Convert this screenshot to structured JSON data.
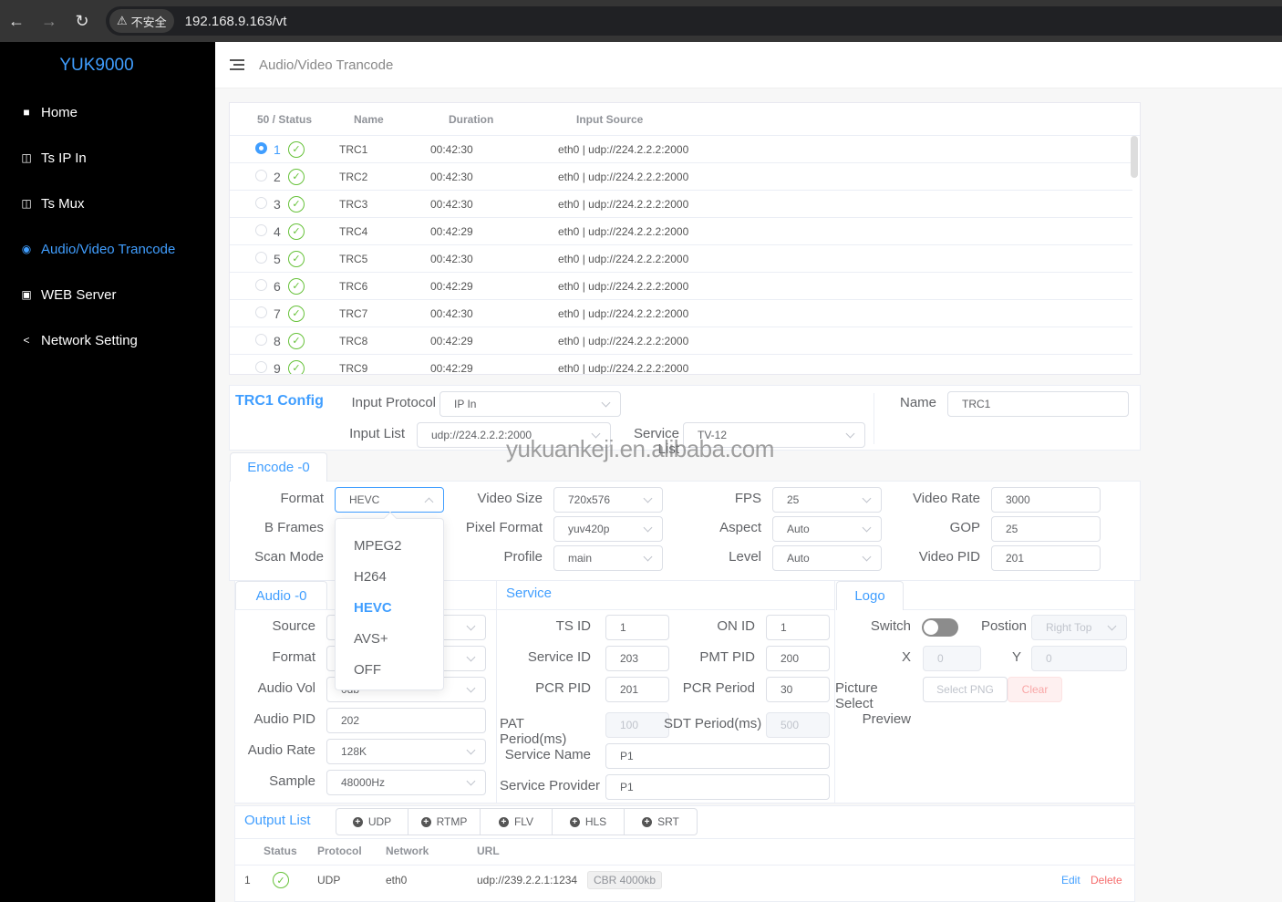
{
  "browser": {
    "insecure_label": "不安全",
    "url": "192.168.9.163/vt"
  },
  "sidebar": {
    "logo": "YUK9000",
    "items": [
      {
        "label": "Home",
        "icon": "monitor-icon",
        "active": false
      },
      {
        "label": "Ts IP In",
        "icon": "notebook-icon",
        "active": false
      },
      {
        "label": "Ts Mux",
        "icon": "notebook-icon",
        "active": false
      },
      {
        "label": "Audio/Video Trancode",
        "icon": "camera-icon",
        "active": true
      },
      {
        "label": "WEB Server",
        "icon": "wallet-icon",
        "active": false
      },
      {
        "label": "Network Setting",
        "icon": "share-icon",
        "active": false
      }
    ]
  },
  "header": {
    "title": "Audio/Video Trancode"
  },
  "channel_table": {
    "headers": [
      "50 / Status",
      "Name",
      "Duration",
      "Input Source"
    ],
    "rows": [
      {
        "index": "1",
        "name": "TRC1",
        "duration": "00:42:30",
        "input": "eth0 | udp://224.2.2.2:2000",
        "selected": true
      },
      {
        "index": "2",
        "name": "TRC2",
        "duration": "00:42:30",
        "input": "eth0 | udp://224.2.2.2:2000",
        "selected": false
      },
      {
        "index": "3",
        "name": "TRC3",
        "duration": "00:42:30",
        "input": "eth0 | udp://224.2.2.2:2000",
        "selected": false
      },
      {
        "index": "4",
        "name": "TRC4",
        "duration": "00:42:29",
        "input": "eth0 | udp://224.2.2.2:2000",
        "selected": false
      },
      {
        "index": "5",
        "name": "TRC5",
        "duration": "00:42:30",
        "input": "eth0 | udp://224.2.2.2:2000",
        "selected": false
      },
      {
        "index": "6",
        "name": "TRC6",
        "duration": "00:42:29",
        "input": "eth0 | udp://224.2.2.2:2000",
        "selected": false
      },
      {
        "index": "7",
        "name": "TRC7",
        "duration": "00:42:30",
        "input": "eth0 | udp://224.2.2.2:2000",
        "selected": false
      },
      {
        "index": "8",
        "name": "TRC8",
        "duration": "00:42:29",
        "input": "eth0 | udp://224.2.2.2:2000",
        "selected": false
      },
      {
        "index": "9",
        "name": "TRC9",
        "duration": "00:42:29",
        "input": "eth0 | udp://224.2.2.2:2000",
        "selected": false
      }
    ]
  },
  "config": {
    "title": "TRC1 Config",
    "input_protocol_label": "Input Protocol",
    "input_protocol": "IP In",
    "input_list_label": "Input List",
    "input_list": "udp://224.2.2.2:2000",
    "service_list_label": "Service List",
    "service_list": "TV-12",
    "name_label": "Name",
    "name": "TRC1"
  },
  "watermark": "yukuankeji.en.alibaba.com",
  "encode": {
    "tab": "Encode -0",
    "format_label": "Format",
    "format": "HEVC",
    "bframes_label": "B Frames",
    "scanmode_label": "Scan Mode",
    "videosize_label": "Video Size",
    "videosize": "720x576",
    "pixelformat_label": "Pixel Format",
    "pixelformat": "yuv420p",
    "profile_label": "Profile",
    "profile": "main",
    "fps_label": "FPS",
    "fps": "25",
    "aspect_label": "Aspect",
    "aspect": "Auto",
    "level_label": "Level",
    "level": "Auto",
    "videorate_label": "Video Rate",
    "videorate": "3000",
    "gop_label": "GOP",
    "gop": "25",
    "videopid_label": "Video PID",
    "videopid": "201",
    "format_options": [
      "MPEG2",
      "H264",
      "HEVC",
      "AVS+",
      "OFF"
    ]
  },
  "audio": {
    "tab": "Audio -0",
    "source_label": "Source",
    "format_label": "Format",
    "vol_label": "Audio Vol",
    "vol": "0db",
    "pid_label": "Audio PID",
    "pid": "202",
    "rate_label": "Audio Rate",
    "rate": "128K",
    "sample_label": "Sample",
    "sample": "48000Hz"
  },
  "service": {
    "tab": "Service",
    "tsid_label": "TS ID",
    "tsid": "1",
    "onid_label": "ON ID",
    "onid": "1",
    "serviceid_label": "Service ID",
    "serviceid": "203",
    "pmtpid_label": "PMT PID",
    "pmtpid": "200",
    "pcrpid_label": "PCR PID",
    "pcrpid": "201",
    "pcrperiod_label": "PCR Period",
    "pcrperiod": "30",
    "patperiod_label": "PAT Period(ms)",
    "patperiod": "100",
    "sdtperiod_label": "SDT Period(ms)",
    "sdtperiod": "500",
    "servicename_label": "Service Name",
    "servicename": "P1",
    "provider_label": "Service Provider",
    "provider": "P1"
  },
  "logo": {
    "tab": "Logo",
    "switch_label": "Switch",
    "switch_on": false,
    "position_label": "Postion",
    "position": "Right Top",
    "x_label": "X",
    "x": "0",
    "y_label": "Y",
    "y": "0",
    "picture_label": "Picture Select",
    "select_png": "Select PNG",
    "clear": "Clear",
    "preview_label": "Preview"
  },
  "output": {
    "title": "Output List",
    "buttons": [
      "UDP",
      "RTMP",
      "FLV",
      "HLS",
      "SRT"
    ],
    "headers": [
      "Status",
      "Protocol",
      "Network",
      "URL"
    ],
    "rows": [
      {
        "index": "1",
        "protocol": "UDP",
        "network": "eth0",
        "url": "udp://239.2.2.1:1234",
        "tag": "CBR 4000kb",
        "edit": "Edit",
        "delete": "Delete"
      }
    ]
  },
  "colors": {
    "accent": "#409eff",
    "success": "#67c23a",
    "danger": "#f56c6c",
    "sidebar_bg": "#000000"
  }
}
